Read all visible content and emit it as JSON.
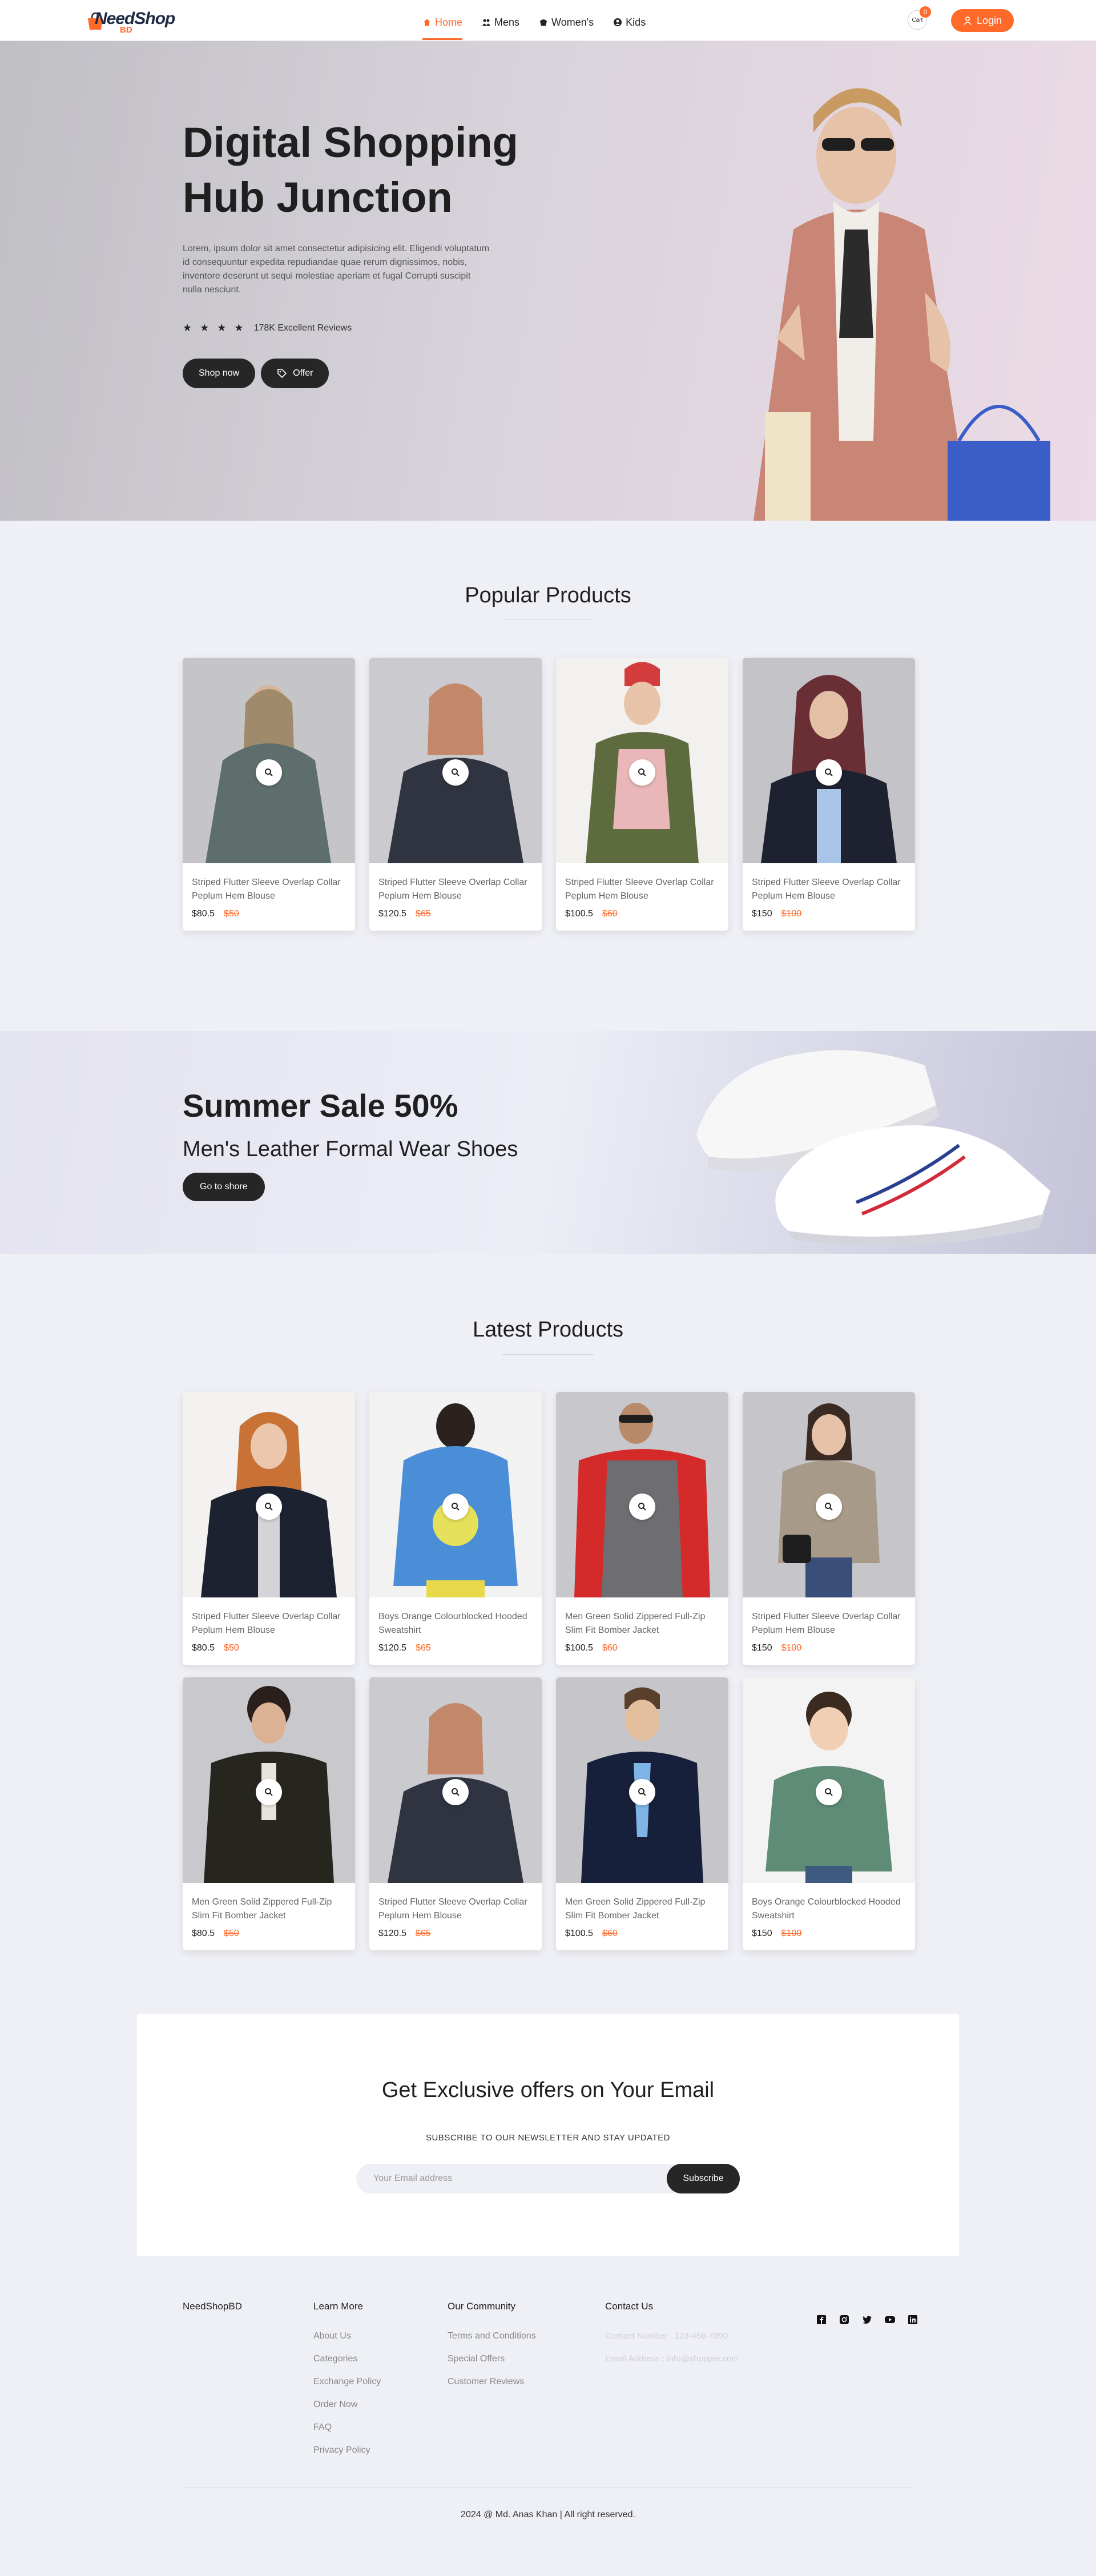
{
  "brand": {
    "name": "NeedShop",
    "suffix": "BD",
    "accent": "#ff6a2a"
  },
  "nav": {
    "items": [
      {
        "label": "Home",
        "icon": "home-icon",
        "active": true
      },
      {
        "label": "Mens",
        "icon": "mens-icon"
      },
      {
        "label": "Women's",
        "icon": "womens-icon"
      },
      {
        "label": "Kids",
        "icon": "kids-icon"
      }
    ],
    "cart_label": "Cart",
    "cart_count": "0",
    "login_label": "Login"
  },
  "hero": {
    "title": "Digital Shopping Hub Junction",
    "description": "Lorem, ipsum dolor sit amet consectetur adipisicing elit. Eligendi voluptatum id consequuntur expedita repudiandae quae rerum dignissimos, nobis, inventore deserunt ut sequi molestiae aperiam et fugal Corrupti suscipit nulla nesciunt.",
    "rating_stars": 4,
    "reviews": "178K Excellent Reviews",
    "shop_label": "Shop now",
    "offer_label": "Offer"
  },
  "popular": {
    "title": "Popular Products",
    "products": [
      {
        "title": "Striped Flutter Sleeve Overlap Collar Peplum Hem Blouse",
        "price": "$80.5",
        "old_price": "$50"
      },
      {
        "title": "Striped Flutter Sleeve Overlap Collar Peplum Hem Blouse",
        "price": "$120.5",
        "old_price": "$65"
      },
      {
        "title": "Striped Flutter Sleeve Overlap Collar Peplum Hem Blouse",
        "price": "$100.5",
        "old_price": "$60"
      },
      {
        "title": "Striped Flutter Sleeve Overlap Collar Peplum Hem Blouse",
        "price": "$150",
        "old_price": "$100"
      }
    ]
  },
  "sale": {
    "title": "Summer Sale 50%",
    "subtitle": "Men's Leather Formal Wear Shoes",
    "button_label": "Go to shore"
  },
  "latest": {
    "title": "Latest Products",
    "products": [
      {
        "title": "Striped Flutter Sleeve Overlap Collar Peplum Hem Blouse",
        "price": "$80.5",
        "old_price": "$50"
      },
      {
        "title": "Boys Orange Colourblocked Hooded Sweatshirt",
        "price": "$120.5",
        "old_price": "$65"
      },
      {
        "title": "Men Green Solid Zippered Full-Zip Slim Fit Bomber Jacket",
        "price": "$100.5",
        "old_price": "$60"
      },
      {
        "title": "Striped Flutter Sleeve Overlap Collar Peplum Hem Blouse",
        "price": "$150",
        "old_price": "$100"
      },
      {
        "title": "Men Green Solid Zippered Full-Zip Slim Fit Bomber Jacket",
        "price": "$80.5",
        "old_price": "$50"
      },
      {
        "title": "Striped Flutter Sleeve Overlap Collar Peplum Hem Blouse",
        "price": "$120.5",
        "old_price": "$65"
      },
      {
        "title": "Men Green Solid Zippered Full-Zip Slim Fit Bomber Jacket",
        "price": "$100.5",
        "old_price": "$60"
      },
      {
        "title": "Boys Orange Colourblocked Hooded Sweatshirt",
        "price": "$150",
        "old_price": "$100"
      }
    ]
  },
  "newsletter": {
    "title": "Get Exclusive offers on Your Email",
    "subtitle": "SUBSCRIBE TO OUR NEWSLETTER AND STAY UPDATED",
    "placeholder": "Your Email address",
    "button_label": "Subscribe"
  },
  "footer": {
    "brand": "NeedShopBD",
    "learn_more": {
      "heading": "Learn More",
      "links": [
        "About Us",
        "Categories",
        "Exchange Policy",
        "Order Now",
        "FAQ",
        "Privacy Policy"
      ]
    },
    "community": {
      "heading": "Our Community",
      "links": [
        "Terms and Conditions",
        "Special Offers",
        "Customer Reviews"
      ]
    },
    "contact": {
      "heading": "Contact Us",
      "number": "Contact Number : 123-456-7890",
      "email": "Email Address : info@shopper.com"
    },
    "socials": [
      "facebook-icon",
      "instagram-icon",
      "twitter-icon",
      "youtube-icon",
      "linkedin-icon"
    ],
    "copyright": "2024 @ Md. Anas Khan | All right reserved."
  }
}
